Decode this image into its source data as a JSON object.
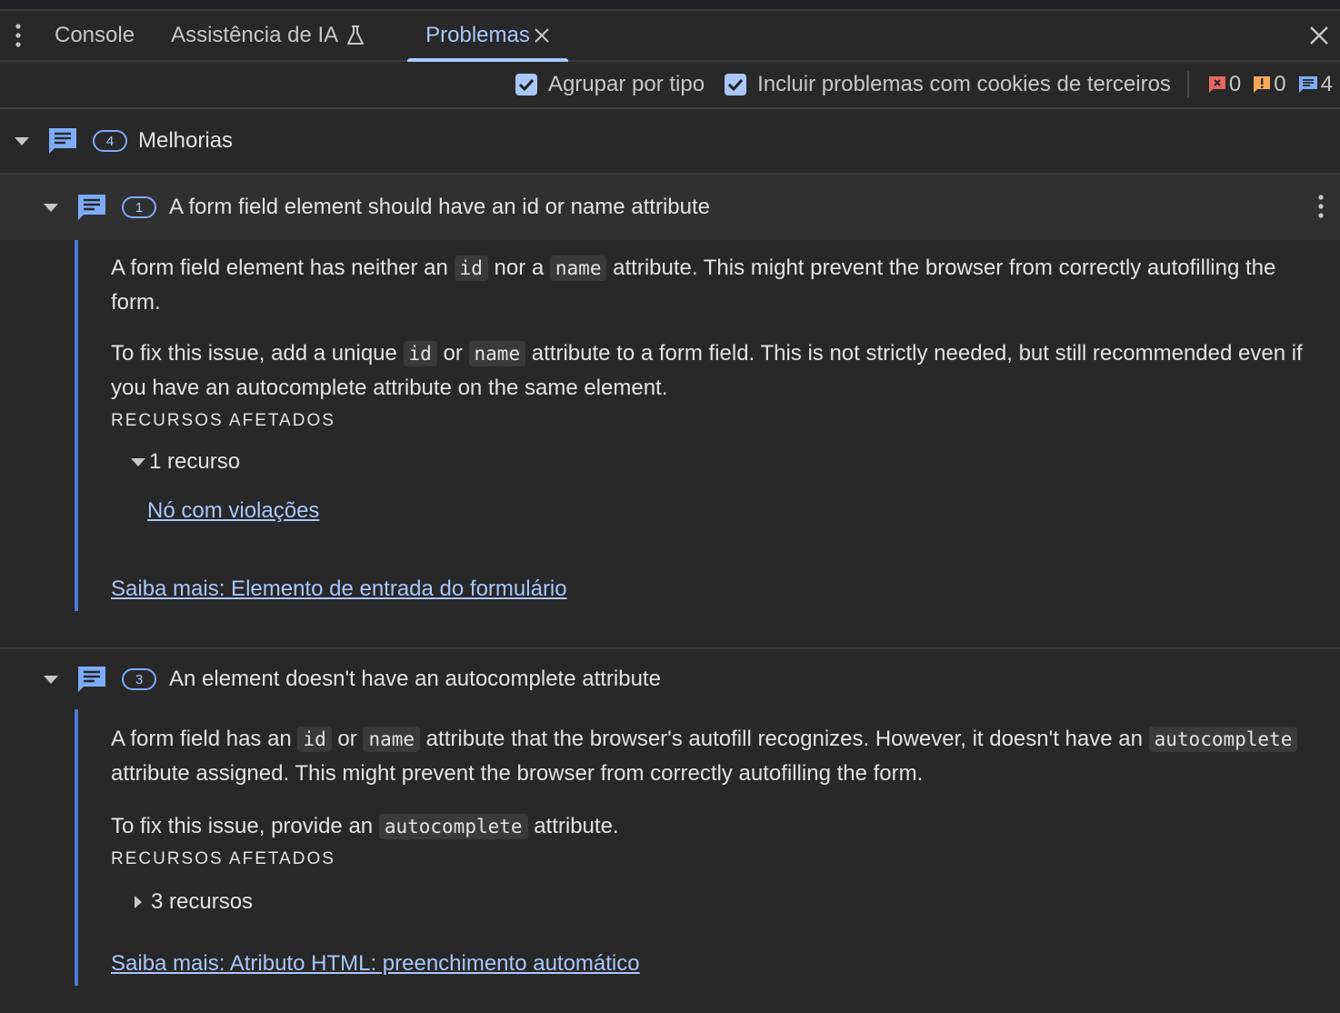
{
  "tabs": [
    {
      "label": "Console"
    },
    {
      "label": "Assistência de IA"
    },
    {
      "label": "Problemas"
    }
  ],
  "toolbar": {
    "group_by_type": "Agrupar por tipo",
    "include_third_party": "Incluir problemas com cookies de terceiros",
    "errors_count": "0",
    "warnings_count": "0",
    "info_count": "4"
  },
  "group": {
    "count": "4",
    "label": "Melhorias"
  },
  "issues": [
    {
      "count": "1",
      "title": "A form field element should have an id or name attribute",
      "p1": {
        "t1": "A form field element has neither an ",
        "c1": "id",
        "t2": " nor a ",
        "c2": "name",
        "t3": " attribute. This might prevent the browser from correctly autofilling the form."
      },
      "p2": {
        "t1": "To fix this issue, add a unique ",
        "c1": "id",
        "t2": " or ",
        "c2": "name",
        "t3": " attribute to a form field. This is not strictly needed, but still recommended even if you have an autocomplete attribute on the same element."
      },
      "affected_heading": "RECURSOS AFETADOS",
      "resources_label": "1 recurso",
      "node_link": "Nó com violações",
      "learn_more": "Saiba mais: Elemento de entrada do formulário"
    },
    {
      "count": "3",
      "title": "An element doesn't have an autocomplete attribute",
      "p1": {
        "t1": "A form field has an ",
        "c1": "id",
        "t2": " or ",
        "c2": "name",
        "t3": " attribute that the browser's autofill recognizes. However, it doesn't have an ",
        "c3": "autocomplete",
        "t4": " attribute assigned. This might prevent the browser from correctly autofilling the form."
      },
      "p2": {
        "t1": "To fix this issue, provide an ",
        "c1": "autocomplete",
        "t2": " attribute."
      },
      "affected_heading": "RECURSOS AFETADOS",
      "resources_label": "3 recursos",
      "learn_more": "Saiba mais: Atributo HTML: preenchimento automático"
    }
  ]
}
